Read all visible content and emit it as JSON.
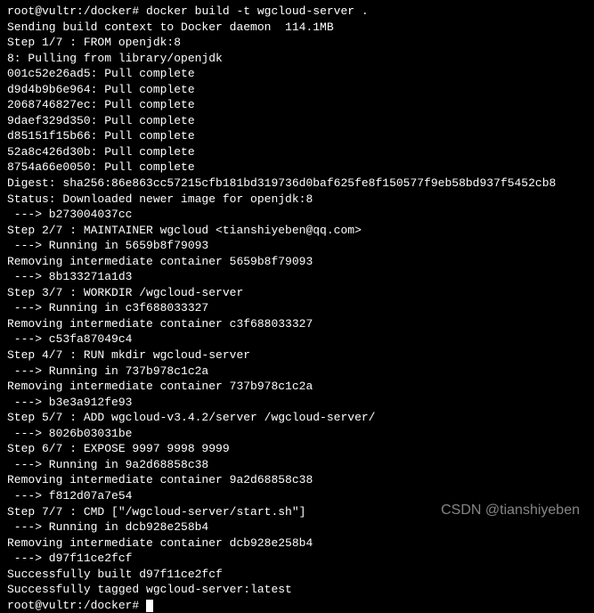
{
  "prompt1": "root@vultr:/docker# ",
  "command": "docker build -t wgcloud-server .",
  "lines": [
    "Sending build context to Docker daemon  114.1MB",
    "Step 1/7 : FROM openjdk:8",
    "8: Pulling from library/openjdk",
    "001c52e26ad5: Pull complete",
    "d9d4b9b6e964: Pull complete",
    "2068746827ec: Pull complete",
    "9daef329d350: Pull complete",
    "d85151f15b66: Pull complete",
    "52a8c426d30b: Pull complete",
    "8754a66e0050: Pull complete",
    "Digest: sha256:86e863cc57215cfb181bd319736d0baf625fe8f150577f9eb58bd937f5452cb8",
    "Status: Downloaded newer image for openjdk:8",
    " ---> b273004037cc",
    "Step 2/7 : MAINTAINER wgcloud <tianshiyeben@qq.com>",
    " ---> Running in 5659b8f79093",
    "Removing intermediate container 5659b8f79093",
    " ---> 8b133271a1d3",
    "Step 3/7 : WORKDIR /wgcloud-server",
    " ---> Running in c3f688033327",
    "Removing intermediate container c3f688033327",
    " ---> c53fa87049c4",
    "Step 4/7 : RUN mkdir wgcloud-server",
    " ---> Running in 737b978c1c2a",
    "Removing intermediate container 737b978c1c2a",
    " ---> b3e3a912fe93",
    "Step 5/7 : ADD wgcloud-v3.4.2/server /wgcloud-server/",
    " ---> 8026b03031be",
    "Step 6/7 : EXPOSE 9997 9998 9999",
    " ---> Running in 9a2d68858c38",
    "Removing intermediate container 9a2d68858c38",
    " ---> f812d07a7e54",
    "Step 7/7 : CMD [\"/wgcloud-server/start.sh\"]",
    " ---> Running in dcb928e258b4",
    "Removing intermediate container dcb928e258b4",
    " ---> d97f11ce2fcf",
    "Successfully built d97f11ce2fcf",
    "Successfully tagged wgcloud-server:latest"
  ],
  "prompt2": "root@vultr:/docker# ",
  "watermark": "CSDN @tianshiyeben"
}
